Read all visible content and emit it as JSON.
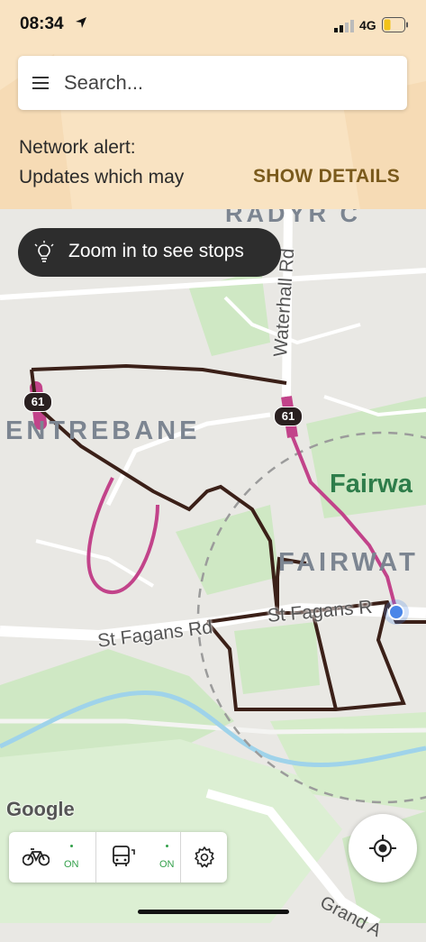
{
  "status_bar": {
    "time": "08:34",
    "network": "4G",
    "icons": [
      "location-arrow-icon",
      "signal-icon",
      "battery-icon"
    ]
  },
  "search": {
    "placeholder": "Search...",
    "icon": "menu-icon"
  },
  "alert": {
    "line1": "Network alert:",
    "line2": "Updates which may",
    "action": "SHOW DETAILS"
  },
  "zoom_hint": {
    "icon": "lightbulb-icon",
    "text": "Zoom in to see stops"
  },
  "map": {
    "places": {
      "radyr": "RADYR C",
      "pentrebane": "ENTREBANE",
      "fairwater_area": "FAIRWAT",
      "fairwater_park": "Fairwa"
    },
    "roads": {
      "waterhall": "Waterhall Rd",
      "st_fagans_1": "St Fagans Rd",
      "st_fagans_2": "St Fagans R",
      "grand": "Grand A"
    },
    "route_badges": [
      "61",
      "61"
    ],
    "attribution": "Google",
    "colors": {
      "route_dark": "#3b2018",
      "route_magenta": "#c2438a",
      "water": "#9fd3ea",
      "park": "#cfe8c4",
      "user_location": "#4a86e8"
    }
  },
  "toolbar": {
    "bike_icon": "bicycle-icon",
    "bike_status": "ON",
    "bus_icon": "bus-icon",
    "bus_status": "ON",
    "settings_icon": "gear-icon"
  },
  "locate_button": {
    "icon": "crosshair-icon"
  }
}
